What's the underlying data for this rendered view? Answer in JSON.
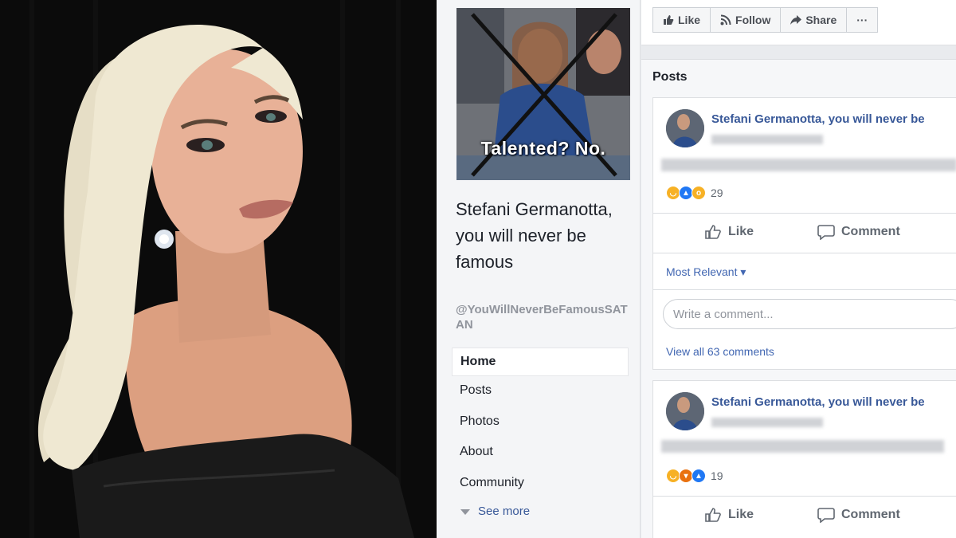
{
  "photo": {
    "bg_color": "#0b0b0b",
    "hair_color": "#ebe4cf",
    "skin_color": "#e2a98c",
    "dress_color": "#1a1a1a"
  },
  "page": {
    "cover_caption": "Talented? No.",
    "name": "Stefani Germanotta, you will never be famous",
    "handle": "@YouWillNeverBeFamousSATAN",
    "nav": [
      {
        "label": "Home",
        "active": true
      },
      {
        "label": "Posts"
      },
      {
        "label": "Photos"
      },
      {
        "label": "About"
      },
      {
        "label": "Community"
      }
    ],
    "see_more": "See more"
  },
  "toolbar": {
    "like": "Like",
    "follow": "Follow",
    "share": "Share",
    "more": "···"
  },
  "posts_title": "Posts",
  "posts": [
    {
      "author": "Stefani Germanotta, you will never be",
      "reactions": [
        "haha",
        "like",
        "wow"
      ],
      "reaction_count": "29",
      "like_label": "Like",
      "comment_label": "Comment",
      "most_relevant": "Most Relevant ▾",
      "comment_placeholder": "Write a comment...",
      "view_all": "View all 63 comments"
    },
    {
      "author": "Stefani Germanotta, you will never be",
      "reactions": [
        "haha",
        "angry",
        "like"
      ],
      "reaction_count": "19",
      "like_label": "Like",
      "comment_label": "Comment"
    }
  ],
  "colors": {
    "fb_blue": "#385898",
    "link_blue": "#4267b2",
    "bg": "#e9ebee"
  }
}
